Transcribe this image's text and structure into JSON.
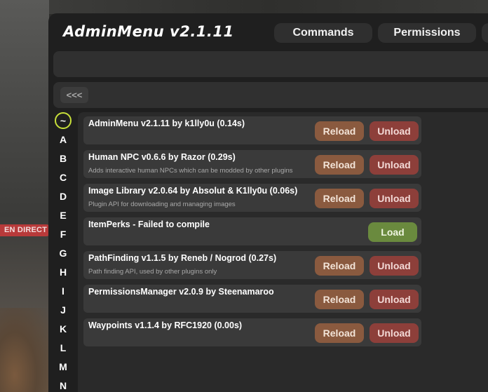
{
  "status_badge": "EN DIRECT",
  "header": {
    "title": "AdminMenu v2.1.11",
    "tabs": [
      "Commands",
      "Permissions"
    ]
  },
  "nav": {
    "back_label": "<<<"
  },
  "letters": [
    "~",
    "A",
    "B",
    "C",
    "D",
    "E",
    "F",
    "G",
    "H",
    "I",
    "J",
    "K",
    "L",
    "M",
    "N"
  ],
  "letters_active": "~",
  "plugins": [
    {
      "name": "AdminMenu v2.1.11 by k1lly0u  (0.14s)",
      "description": "",
      "actions": [
        "Reload",
        "Unload"
      ]
    },
    {
      "name": "Human NPC v0.6.6 by Razor  (0.29s)",
      "description": "Adds interactive human NPCs which can be modded by other plugins",
      "actions": [
        "Reload",
        "Unload"
      ]
    },
    {
      "name": "Image Library v2.0.64 by Absolut & K1lly0u  (0.06s)",
      "description": "Plugin API for downloading and managing images",
      "actions": [
        "Reload",
        "Unload"
      ]
    },
    {
      "name": "ItemPerks - Failed to compile",
      "description": "",
      "actions": [
        "Load"
      ]
    },
    {
      "name": "PathFinding v1.1.5 by Reneb / Nogrod  (0.27s)",
      "description": "Path finding API, used by other plugins only",
      "actions": [
        "Reload",
        "Unload"
      ]
    },
    {
      "name": "PermissionsManager v2.0.9 by Steenamaroo",
      "description": "",
      "actions": [
        "Reload",
        "Unload"
      ]
    },
    {
      "name": "Waypoints v1.1.4 by RFC1920  (0.00s)",
      "description": "",
      "actions": [
        "Reload",
        "Unload"
      ]
    }
  ],
  "colors": {
    "reload": "#8a5a3f",
    "unload": "#8d3f3a",
    "load": "#6a8a3e",
    "active_letter_ring": "#c8e03a",
    "live_badge": "#b83a3a"
  }
}
